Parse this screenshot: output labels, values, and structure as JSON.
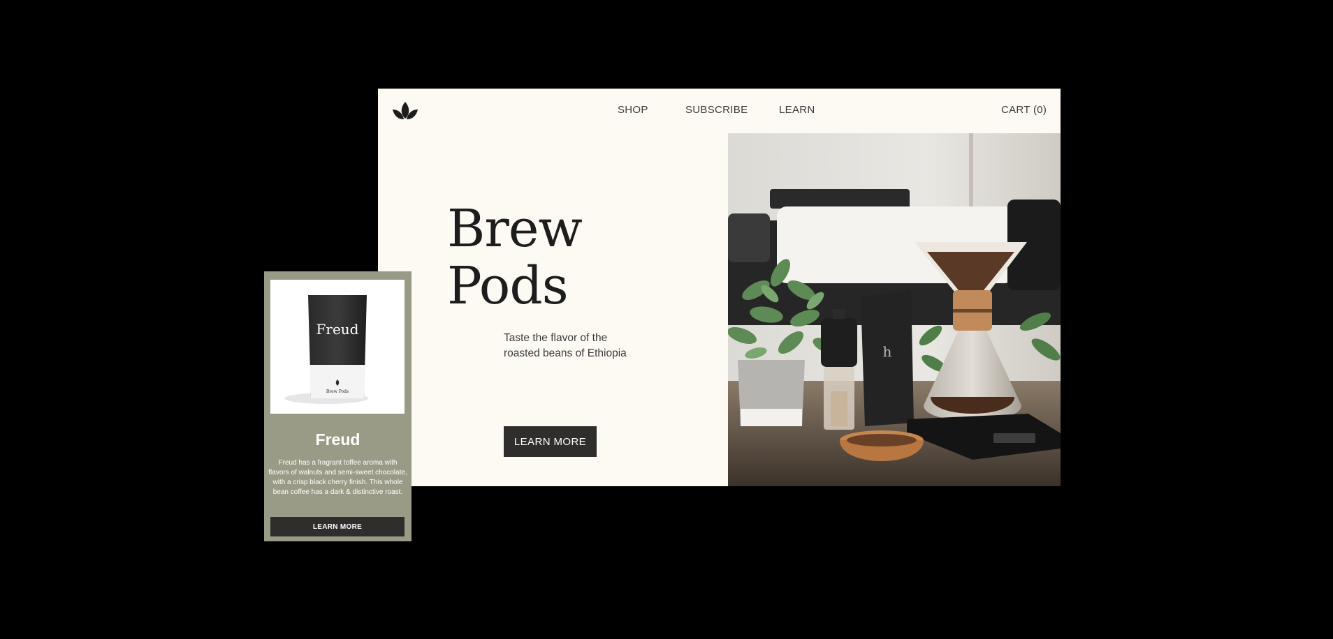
{
  "nav": {
    "links": [
      "SHOP",
      "SUBSCRIBE",
      "LEARN"
    ],
    "cart": "CART (0)",
    "logo_icon": "leaf-logo-icon"
  },
  "hero": {
    "title_line1": "Brew",
    "title_line2": "Pods",
    "subtitle_line1": "Taste the flavor of the",
    "subtitle_line2": "roasted beans of Ethiopia",
    "button": "LEARN MORE"
  },
  "product": {
    "bag_label": "Freud",
    "bag_brand": "Brew Pods",
    "title": "Freud",
    "description": "Freud has a fragrant toffee aroma with flavors of walnuts and semi-sweet chocolate, with a crisp black cherry finish. This whole bean coffee has a dark & distinctive roast.",
    "button": "LEARN MORE"
  },
  "colors": {
    "site_background": "#fdfaf3",
    "card_background": "#9a9b86",
    "button_dark": "#2f2e2d",
    "page_background": "#000000"
  }
}
